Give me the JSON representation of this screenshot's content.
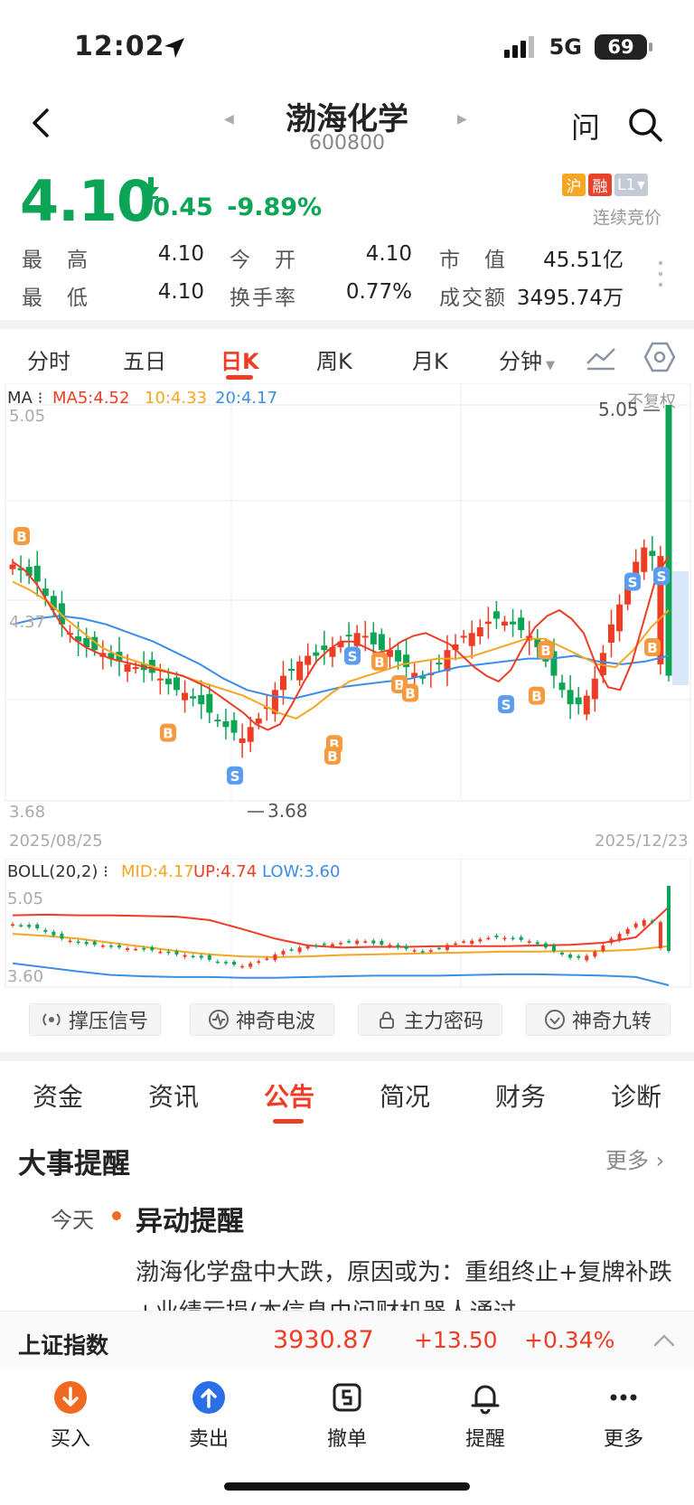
{
  "status_bar": {
    "time": "12:02",
    "network": "5G",
    "battery": "69"
  },
  "nav": {
    "title": "渤海化学",
    "code": "600800",
    "ask": "问"
  },
  "quote": {
    "price": "4.10",
    "change": "-0.45",
    "change_pct": "-9.89%",
    "badges": [
      "沪",
      "融",
      "L1"
    ],
    "trade_status": "连续竞价",
    "stats": [
      {
        "label": "最　高",
        "value": "4.10"
      },
      {
        "label": "今　开",
        "value": "4.10"
      },
      {
        "label": "市　值",
        "value": "45.51亿"
      },
      {
        "label": "最　低",
        "value": "4.10"
      },
      {
        "label": "换手率",
        "value": "0.77%"
      },
      {
        "label": "成交额",
        "value": "3495.74万"
      }
    ]
  },
  "chart_tabs": [
    "分时",
    "五日",
    "日K",
    "周K",
    "月K",
    "分钟"
  ],
  "chart_tab_active": "日K",
  "ma_legend": {
    "label": "MA",
    "ma5": "MA5:4.52",
    "ma10": "10:4.33",
    "ma20": "20:4.17",
    "adjust": "不复权"
  },
  "colors": {
    "up": "#ee3d24",
    "down": "#0ca555",
    "ma5": "#ee3d24",
    "ma10": "#f5a623",
    "ma20": "#3b8ee8",
    "accent": "#ee3d24"
  },
  "chart_data": {
    "type": "candlestick",
    "ylim": [
      3.68,
      5.05
    ],
    "high_label": "5.05",
    "low_label": "3.68",
    "y_ticks": [
      "5.05",
      "4.37",
      "3.68"
    ],
    "x_labels": [
      "2025/08/25",
      "2025/12/23"
    ],
    "closes": [
      4.49,
      4.47,
      4.45,
      4.43,
      4.38,
      4.33,
      4.28,
      4.25,
      4.22,
      4.2,
      4.19,
      4.18,
      4.16,
      4.15,
      4.14,
      4.13,
      4.12,
      4.11,
      4.09,
      4.07,
      4.05,
      4.04,
      4.02,
      4.0,
      3.97,
      3.94,
      3.92,
      3.9,
      3.88,
      3.92,
      3.95,
      3.99,
      4.05,
      4.1,
      4.12,
      4.15,
      4.17,
      4.17,
      4.19,
      4.2,
      4.22,
      4.24,
      4.25,
      4.24,
      4.21,
      4.19,
      4.19,
      4.15,
      4.13,
      4.11,
      4.09,
      4.11,
      4.14,
      4.19,
      4.21,
      4.24,
      4.25,
      4.27,
      4.29,
      4.3,
      4.29,
      4.28,
      4.26,
      4.24,
      4.2,
      4.15,
      4.1,
      4.05,
      4.0,
      4.0,
      4.03,
      4.09,
      4.18,
      4.28,
      4.35,
      4.42,
      4.5,
      4.55,
      4.52,
      4.52,
      4.1
    ],
    "ma5": [
      4.5,
      4.47,
      4.42,
      4.35,
      4.28,
      4.23,
      4.2,
      4.18,
      4.16,
      4.15,
      4.14,
      4.13,
      4.12,
      4.11,
      4.1,
      4.08,
      4.06,
      4.03,
      4.0,
      3.97,
      3.93,
      3.91,
      3.93,
      4.0,
      4.08,
      4.15,
      4.19,
      4.22,
      4.22,
      4.2,
      4.18,
      4.19,
      4.22,
      4.24,
      4.25,
      4.23,
      4.21,
      4.17,
      4.13,
      4.1,
      4.08,
      4.12,
      4.2,
      4.27,
      4.31,
      4.33,
      4.3,
      4.25,
      4.14,
      4.06,
      4.05,
      4.15,
      4.3,
      4.45,
      4.52
    ],
    "ma10": [
      4.43,
      4.4,
      4.36,
      4.3,
      4.25,
      4.2,
      4.17,
      4.15,
      4.13,
      4.11,
      4.09,
      4.07,
      4.05,
      4.03,
      4.0,
      3.97,
      3.95,
      3.99,
      4.04,
      4.08,
      4.1,
      4.12,
      4.14,
      4.15,
      4.16,
      4.16,
      4.17,
      4.19,
      4.21,
      4.23,
      4.23,
      4.2,
      4.17,
      4.14,
      4.13,
      4.19,
      4.27,
      4.33
    ],
    "ma20": [
      4.28,
      4.3,
      4.31,
      4.3,
      4.28,
      4.25,
      4.22,
      4.18,
      4.14,
      4.09,
      4.05,
      4.03,
      4.02,
      4.04,
      4.06,
      4.07,
      4.08,
      4.09,
      4.11,
      4.13,
      4.14,
      4.15,
      4.16,
      4.16,
      4.17,
      4.15,
      4.14,
      4.15,
      4.17
    ]
  },
  "boll": {
    "label": "BOLL(20,2)",
    "mid": "MID:4.17",
    "up": "UP:4.74",
    "low": "LOW:3.60",
    "y_top": "5.05",
    "y_bottom": "3.60"
  },
  "signals": [
    "撑压信号",
    "神奇电波",
    "主力密码",
    "神奇九转"
  ],
  "info_tabs": [
    "资金",
    "资讯",
    "公告",
    "简况",
    "财务",
    "诊断"
  ],
  "info_tab_active": "公告",
  "events": {
    "title": "大事提醒",
    "more": "更多",
    "items": [
      {
        "date": "今天",
        "title": "异动提醒",
        "body": "渤海化学盘中大跌，原因或为：重组终止+复牌补跌+业绩亏损(本信息由问财机器人通过"
      }
    ]
  },
  "index_bar": {
    "name": "上证指数",
    "price": "3930.87",
    "change": "+13.50",
    "pct": "+0.34%"
  },
  "bottom_actions": [
    "买入",
    "卖出",
    "撤单",
    "提醒",
    "更多"
  ]
}
